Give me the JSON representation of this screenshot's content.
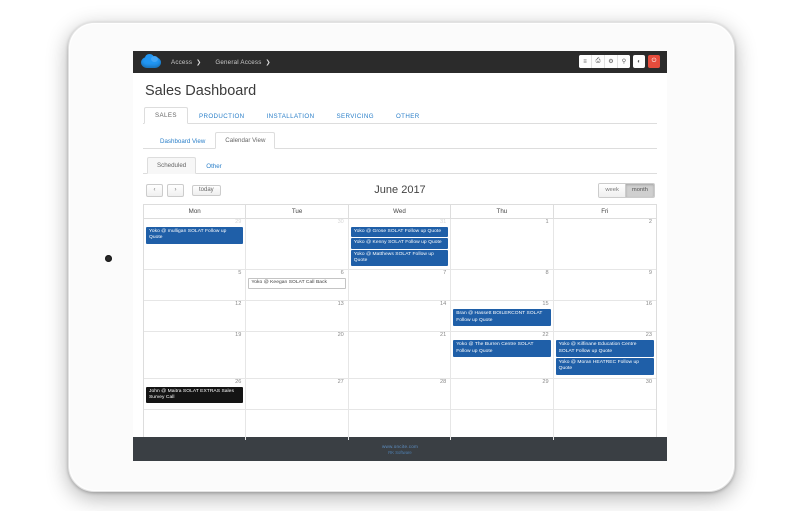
{
  "topbar": {
    "logo_name": "cloud-logo",
    "breadcrumbs": [
      {
        "label": "Access",
        "chevron": "❯"
      },
      {
        "label": "General Access",
        "chevron": "❯"
      }
    ],
    "buttons": [
      {
        "name": "list-icon",
        "glyph": "≡"
      },
      {
        "name": "print-icon",
        "glyph": "⎙"
      },
      {
        "name": "help-icon",
        "glyph": "⚙"
      },
      {
        "name": "search-icon",
        "glyph": "⚲"
      }
    ],
    "contrast_button": {
      "name": "contrast-icon",
      "glyph": "◐"
    },
    "power_button": {
      "name": "power-icon",
      "glyph": "⏻"
    },
    "accent_red": "#e74c3c",
    "accent_blue": "#2196f3"
  },
  "page": {
    "title": "Sales Dashboard"
  },
  "main_tabs": [
    {
      "label": "SALES",
      "active": true
    },
    {
      "label": "PRODUCTION",
      "active": false
    },
    {
      "label": "INSTALLATION",
      "active": false
    },
    {
      "label": "SERVICING",
      "active": false
    },
    {
      "label": "OTHER",
      "active": false
    }
  ],
  "sub_tabs": [
    {
      "label": "Dashboard View",
      "active": false
    },
    {
      "label": "Calendar View",
      "active": true
    }
  ],
  "pill_tabs": [
    {
      "label": "Scheduled",
      "active": true
    },
    {
      "label": "Other",
      "active": false
    }
  ],
  "calendar_toolbar": {
    "prev_label": "‹",
    "next_label": "›",
    "today_label": "today",
    "title": "June 2017",
    "views": [
      {
        "label": "week",
        "active": false
      },
      {
        "label": "month",
        "active": true
      }
    ]
  },
  "calendar": {
    "day_headers": [
      "Mon",
      "Tue",
      "Wed",
      "Thu",
      "Fri"
    ],
    "weeks": [
      {
        "days": [
          {
            "num": "29",
            "muted": true,
            "events": [
              {
                "title": "Yoko @ mulligan SOLAT Follow up Quote",
                "style": "blue"
              }
            ]
          },
          {
            "num": "30",
            "muted": true,
            "events": []
          },
          {
            "num": "31",
            "muted": true,
            "events": [
              {
                "title": "Yoko @ Grose SOLAT Follow up Quote",
                "style": "blue"
              },
              {
                "title": "Yoko @ Kenny SOLAT Follow up Quote",
                "style": "blue"
              },
              {
                "title": "Yoko @ Matthews SOLAT Follow up Quote",
                "style": "blue"
              }
            ]
          },
          {
            "num": "1",
            "muted": false,
            "events": []
          },
          {
            "num": "2",
            "muted": false,
            "events": []
          }
        ]
      },
      {
        "days": [
          {
            "num": "5",
            "muted": false,
            "events": []
          },
          {
            "num": "6",
            "muted": false,
            "events": [
              {
                "title": "Yoko @ Keegan SOLAT Call Back",
                "style": "white"
              }
            ]
          },
          {
            "num": "7",
            "muted": false,
            "events": []
          },
          {
            "num": "8",
            "muted": false,
            "events": []
          },
          {
            "num": "9",
            "muted": false,
            "events": []
          }
        ]
      },
      {
        "days": [
          {
            "num": "12",
            "muted": false,
            "events": []
          },
          {
            "num": "13",
            "muted": false,
            "events": []
          },
          {
            "num": "14",
            "muted": false,
            "events": []
          },
          {
            "num": "15",
            "muted": false,
            "events": [
              {
                "title": "Bran @ Hassett BOILERCONT SOLAT Follow up Quote",
                "style": "blue"
              }
            ]
          },
          {
            "num": "16",
            "muted": false,
            "events": []
          }
        ]
      },
      {
        "days": [
          {
            "num": "19",
            "muted": false,
            "events": []
          },
          {
            "num": "20",
            "muted": false,
            "events": []
          },
          {
            "num": "21",
            "muted": false,
            "events": []
          },
          {
            "num": "22",
            "muted": false,
            "events": [
              {
                "title": "Yoko @ The Burren Centre SOLAT Follow up Quote",
                "style": "blue"
              }
            ]
          },
          {
            "num": "23",
            "muted": false,
            "events": [
              {
                "title": "Yoko @ Kilfinane Education Centre SOLAT Follow up Quote",
                "style": "blue"
              },
              {
                "title": "Yoko @ Moran HEATREC Follow up Quote",
                "style": "blue"
              }
            ]
          }
        ]
      },
      {
        "days": [
          {
            "num": "26",
            "muted": false,
            "events": [
              {
                "title": "John @ Maitra SOLAT EXTRAS Sales Survey Call",
                "style": "black"
              }
            ]
          },
          {
            "num": "27",
            "muted": false,
            "events": []
          },
          {
            "num": "28",
            "muted": false,
            "events": []
          },
          {
            "num": "29",
            "muted": false,
            "events": []
          },
          {
            "num": "30",
            "muted": false,
            "events": []
          }
        ]
      },
      {
        "days": [
          {
            "num": "",
            "muted": true,
            "events": []
          },
          {
            "num": "",
            "muted": true,
            "events": []
          },
          {
            "num": "",
            "muted": true,
            "events": []
          },
          {
            "num": "",
            "muted": true,
            "events": []
          },
          {
            "num": "",
            "muted": true,
            "events": []
          }
        ]
      }
    ]
  },
  "footer": {
    "link": "www.oncite.com",
    "sub": "RK Software"
  }
}
